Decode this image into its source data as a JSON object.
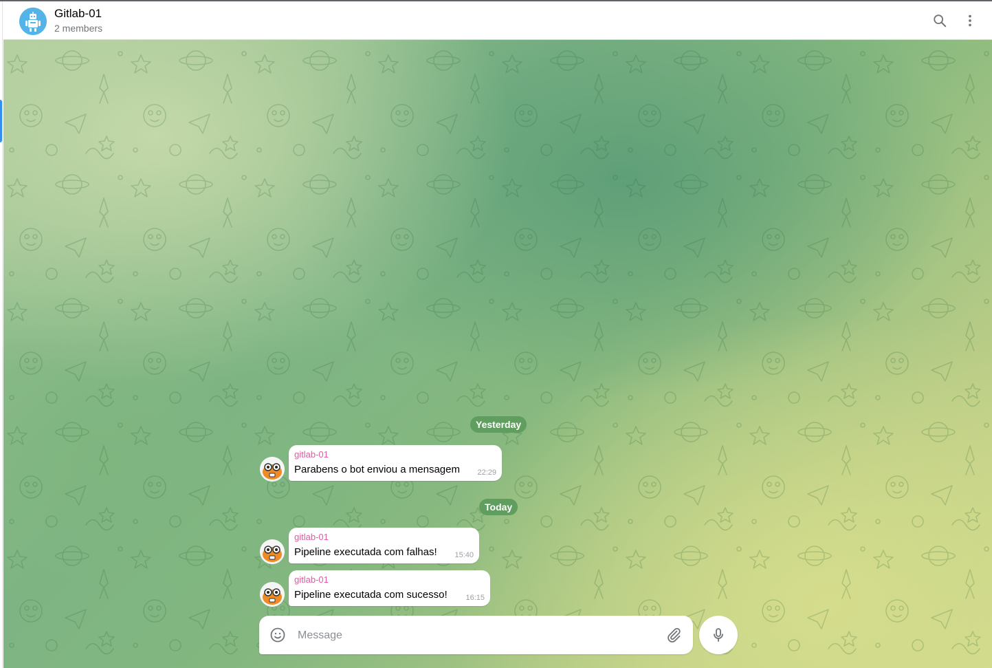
{
  "header": {
    "title": "Gitlab-01",
    "subtitle": "2 members",
    "search_icon": "search-icon",
    "more_icon": "more-vertical-icon"
  },
  "chat": {
    "date_separators": [
      "Yesterday",
      "Today"
    ],
    "messages": [
      {
        "sender": "gitlab-01",
        "text": "Parabens o bot enviou a mensagem",
        "time": "22:29"
      },
      {
        "sender": "gitlab-01",
        "text": "Pipeline executada com falhas!",
        "time": "15:40"
      },
      {
        "sender": "gitlab-01",
        "text": "Pipeline executada com sucesso!",
        "time": "16:15"
      }
    ]
  },
  "composer": {
    "placeholder": "Message",
    "value": "",
    "emoji_icon": "emoji-icon",
    "attach_icon": "paperclip-icon",
    "mic_icon": "microphone-icon"
  },
  "colors": {
    "accent": "#3390ec",
    "sender_name": "#e05ba0",
    "date_pill": "#5f9e5e",
    "group_avatar": "#54b4e8"
  }
}
